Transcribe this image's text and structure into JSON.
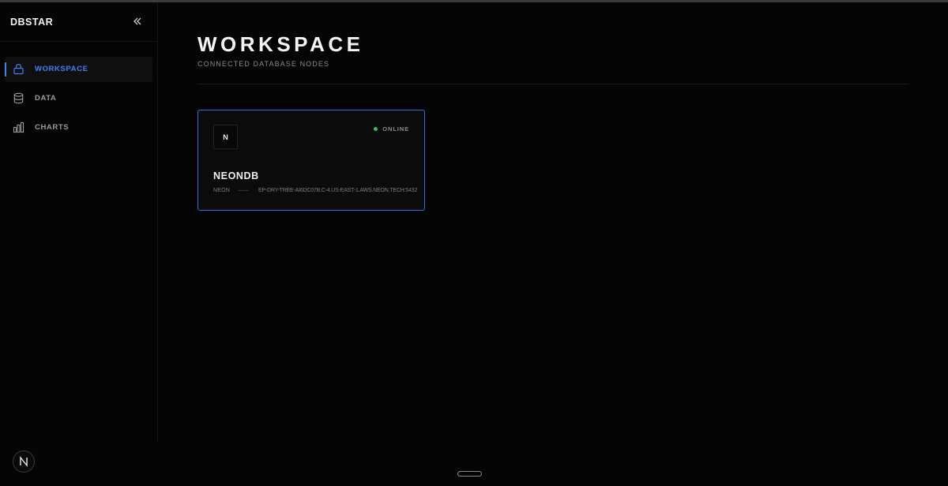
{
  "app": {
    "brand": "DBSTAR"
  },
  "sidebar": {
    "items": [
      {
        "label": "WORKSPACE",
        "icon": "lock-icon",
        "active": true
      },
      {
        "label": "DATA",
        "icon": "database-icon",
        "active": false
      },
      {
        "label": "CHARTS",
        "icon": "bar-chart-icon",
        "active": false
      }
    ],
    "avatar_initial": "N"
  },
  "main": {
    "title": "WORKSPACE",
    "subtitle": "CONNECTED DATABASE NODES",
    "nodes": [
      {
        "logo_letter": "N",
        "status": "ONLINE",
        "name": "NEONDB",
        "provider": "NEON",
        "host": "EP-DRY-TREE-AI6DC07B.C-4.US-EAST-1.AWS.NEON.TECH:5432"
      }
    ]
  },
  "colors": {
    "accent": "#3b82f6",
    "online": "#22c55e",
    "background": "#050505"
  }
}
